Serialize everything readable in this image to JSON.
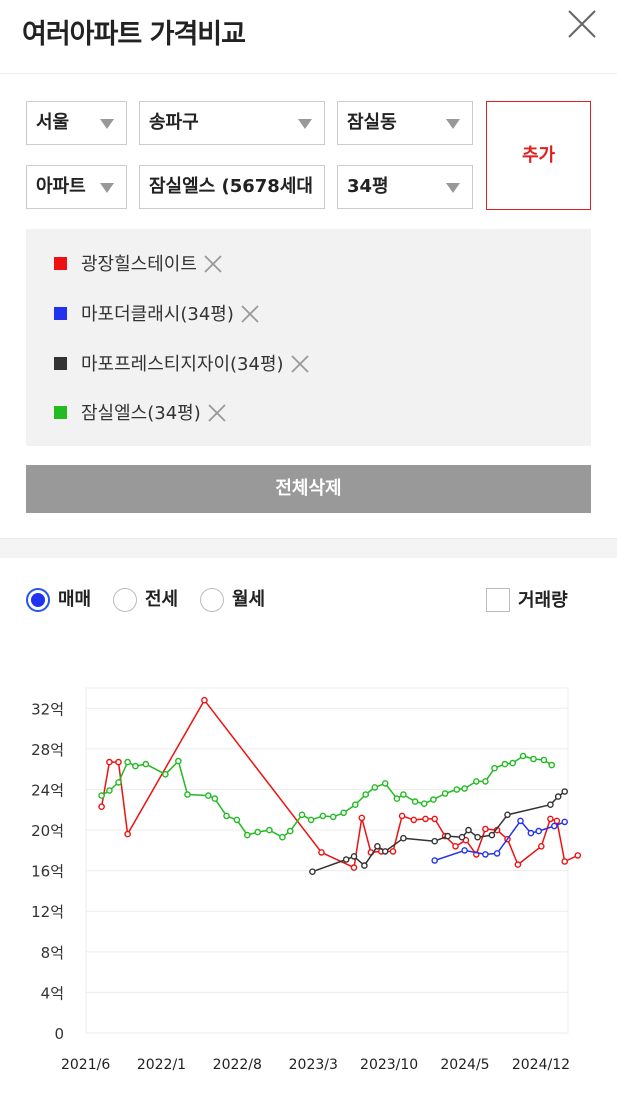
{
  "header": {
    "title": "여러아파트 가격비교"
  },
  "filters": {
    "region": "서울",
    "district": "송파구",
    "dong": "잠실동",
    "type": "아파트",
    "complex": "잠실엘스 (5678세대",
    "size": "34평",
    "add_label": "추가"
  },
  "compare_list": [
    {
      "label": "광장힐스테이트",
      "color": "#ee1111"
    },
    {
      "label": "마포더클래시(34평)",
      "color": "#2233ee"
    },
    {
      "label": "마포프레스티지자이(34평)",
      "color": "#333333"
    },
    {
      "label": "잠실엘스(34평)",
      "color": "#22bb22"
    }
  ],
  "delete_all_label": "전체삭제",
  "trade_types": [
    {
      "label": "매매",
      "selected": true
    },
    {
      "label": "전세",
      "selected": false
    },
    {
      "label": "월세",
      "selected": false
    }
  ],
  "volume_label": "거래량",
  "chart_data": {
    "type": "line",
    "ylim": [
      0,
      34
    ],
    "yticks": [
      0,
      4,
      8,
      12,
      16,
      20,
      24,
      28,
      32
    ],
    "ytick_labels": [
      "0",
      "4억",
      "8억",
      "12억",
      "16억",
      "20억",
      "24억",
      "28억",
      "32억"
    ],
    "xlim": [
      2021.42,
      2025.125
    ],
    "xticks": [
      2021.417,
      2022.0,
      2022.583,
      2023.167,
      2023.75,
      2024.333,
      2024.917
    ],
    "xtick_labels": [
      "2021/6",
      "2022/1",
      "2022/8",
      "2023/3",
      "2023/10",
      "2024/5",
      "2024/12"
    ],
    "grid": true,
    "series": [
      {
        "name": "광장힐스테이트",
        "color": "#ee1111",
        "points": [
          [
            2021.54,
            22.3
          ],
          [
            2021.6,
            26.7
          ],
          [
            2021.67,
            26.7
          ],
          [
            2021.74,
            19.6
          ],
          [
            2022.33,
            32.8
          ],
          [
            2023.23,
            17.8
          ],
          [
            2023.48,
            16.3
          ],
          [
            2023.54,
            21.2
          ],
          [
            2023.61,
            17.8
          ],
          [
            2023.69,
            17.9
          ],
          [
            2023.78,
            17.9
          ],
          [
            2023.85,
            21.4
          ],
          [
            2023.94,
            21.0
          ],
          [
            2024.03,
            21.1
          ],
          [
            2024.1,
            21.1
          ],
          [
            2024.18,
            19.4
          ],
          [
            2024.26,
            18.4
          ],
          [
            2024.34,
            19.0
          ],
          [
            2024.42,
            17.6
          ],
          [
            2024.49,
            20.1
          ],
          [
            2024.58,
            20.0
          ],
          [
            2024.66,
            19.1
          ],
          [
            2024.74,
            16.6
          ],
          [
            2024.92,
            18.4
          ],
          [
            2024.99,
            21.1
          ],
          [
            2025.04,
            20.9
          ],
          [
            2025.1,
            16.9
          ],
          [
            2025.2,
            17.5
          ]
        ]
      },
      {
        "name": "마포더클래시(34평)",
        "color": "#2233ee",
        "points": [
          [
            2024.1,
            17.0
          ],
          [
            2024.33,
            18.0
          ],
          [
            2024.49,
            17.6
          ],
          [
            2024.58,
            17.7
          ],
          [
            2024.76,
            20.9
          ],
          [
            2024.84,
            19.7
          ],
          [
            2024.9,
            19.9
          ],
          [
            2025.02,
            20.4
          ],
          [
            2025.1,
            20.8
          ]
        ]
      },
      {
        "name": "마포프레스티지자이(34평)",
        "color": "#333333",
        "points": [
          [
            2023.16,
            15.9
          ],
          [
            2023.42,
            17.1
          ],
          [
            2023.48,
            17.4
          ],
          [
            2023.56,
            16.5
          ],
          [
            2023.66,
            18.4
          ],
          [
            2023.72,
            17.9
          ],
          [
            2023.86,
            19.2
          ],
          [
            2024.1,
            18.9
          ],
          [
            2024.2,
            19.4
          ],
          [
            2024.31,
            19.3
          ],
          [
            2024.36,
            20.0
          ],
          [
            2024.43,
            19.3
          ],
          [
            2024.54,
            19.5
          ],
          [
            2024.66,
            21.5
          ],
          [
            2024.99,
            22.5
          ],
          [
            2025.05,
            23.3
          ],
          [
            2025.1,
            23.8
          ]
        ]
      },
      {
        "name": "잠실엘스(34평)",
        "color": "#22bb22",
        "points": [
          [
            2021.54,
            23.4
          ],
          [
            2021.6,
            23.9
          ],
          [
            2021.67,
            24.7
          ],
          [
            2021.74,
            26.7
          ],
          [
            2021.8,
            26.3
          ],
          [
            2021.88,
            26.5
          ],
          [
            2022.03,
            25.5
          ],
          [
            2022.13,
            26.8
          ],
          [
            2022.2,
            23.5
          ],
          [
            2022.36,
            23.4
          ],
          [
            2022.41,
            23.1
          ],
          [
            2022.5,
            21.4
          ],
          [
            2022.58,
            21.0
          ],
          [
            2022.66,
            19.5
          ],
          [
            2022.74,
            19.8
          ],
          [
            2022.83,
            20.0
          ],
          [
            2022.93,
            19.3
          ],
          [
            2022.99,
            19.9
          ],
          [
            2023.08,
            21.5
          ],
          [
            2023.15,
            21.0
          ],
          [
            2023.24,
            21.4
          ],
          [
            2023.32,
            21.3
          ],
          [
            2023.4,
            21.7
          ],
          [
            2023.49,
            22.5
          ],
          [
            2023.57,
            23.5
          ],
          [
            2023.64,
            24.2
          ],
          [
            2023.72,
            24.6
          ],
          [
            2023.81,
            23.1
          ],
          [
            2023.86,
            23.5
          ],
          [
            2023.95,
            22.8
          ],
          [
            2024.02,
            22.6
          ],
          [
            2024.09,
            23.0
          ],
          [
            2024.18,
            23.6
          ],
          [
            2024.27,
            24.0
          ],
          [
            2024.33,
            24.1
          ],
          [
            2024.42,
            24.8
          ],
          [
            2024.49,
            24.8
          ],
          [
            2024.56,
            26.1
          ],
          [
            2024.64,
            26.5
          ],
          [
            2024.7,
            26.6
          ],
          [
            2024.78,
            27.3
          ],
          [
            2024.86,
            27.0
          ],
          [
            2024.94,
            26.9
          ],
          [
            2025.0,
            26.4
          ]
        ]
      }
    ]
  }
}
